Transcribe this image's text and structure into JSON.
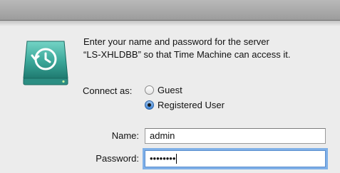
{
  "dialog": {
    "message_line1": "Enter your name and password for the server",
    "message_line2": "“LS-XHLDBB” so that Time Machine can access it.",
    "connect_as_label": "Connect as:",
    "options": [
      "Guest",
      "Registered User"
    ],
    "selected_option": "Registered User",
    "name_label": "Name:",
    "name_value": "admin",
    "password_label": "Password:",
    "password_value": "••••••••"
  },
  "icons": {
    "app_icon": "time-machine-drive-icon"
  },
  "colors": {
    "focus_ring": "#7fb0e8",
    "drive_teal": "#3fa59b",
    "radio_selected": "#3d84d6"
  }
}
